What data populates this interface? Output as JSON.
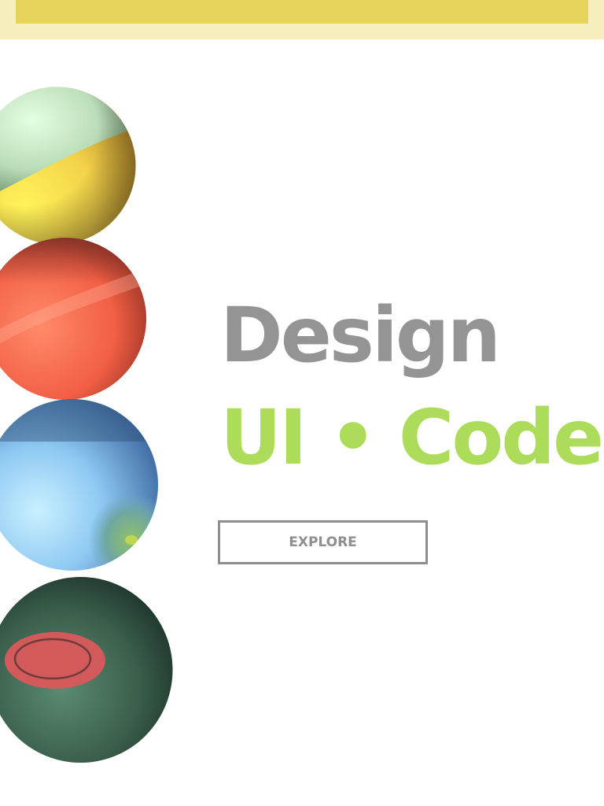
{
  "hero": {
    "title": "Design",
    "subtitle": "UI • Code",
    "explore_label": "EXPLORE"
  },
  "colors": {
    "top_bar_outer": "#f7efbd",
    "top_bar_inner": "#e6d35c",
    "title": "#949494",
    "subtitle": "#acdc5a",
    "button_border": "#8f8f8f"
  },
  "decor": {
    "spheres": [
      "yellow-green-sphere",
      "red-sphere",
      "blue-sphere",
      "dark-green-sphere"
    ]
  }
}
